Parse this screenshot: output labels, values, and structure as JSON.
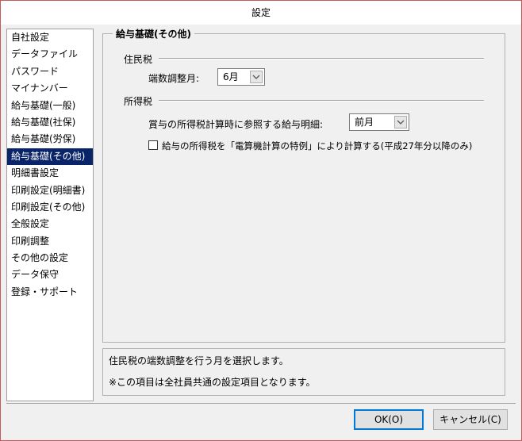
{
  "window": {
    "title": "設定"
  },
  "sidebar": {
    "items": [
      {
        "label": "自社設定"
      },
      {
        "label": "データファイル"
      },
      {
        "label": "パスワード"
      },
      {
        "label": "マイナンバー"
      },
      {
        "label": "給与基礎(一般)"
      },
      {
        "label": "給与基礎(社保)"
      },
      {
        "label": "給与基礎(労保)"
      },
      {
        "label": "給与基礎(その他)",
        "selected": true
      },
      {
        "label": "明細書設定"
      },
      {
        "label": "印刷設定(明細書)"
      },
      {
        "label": "印刷設定(その他)"
      },
      {
        "label": "全般設定"
      },
      {
        "label": "印刷調整"
      },
      {
        "label": "その他の設定"
      },
      {
        "label": "データ保守"
      },
      {
        "label": "登録・サポート"
      }
    ]
  },
  "main": {
    "group_title": "給与基礎(その他)",
    "resident_tax": {
      "section_label": "住民税",
      "rounding_month_label": "端数調整月:",
      "rounding_month_value": "6月"
    },
    "income_tax": {
      "section_label": "所得税",
      "bonus_ref_label": "賞与の所得税計算時に参照する給与明細:",
      "bonus_ref_value": "前月",
      "special_calc_checked": false,
      "special_calc_label": "給与の所得税を「電算機計算の特例」により計算する(平成27年分以降のみ)"
    }
  },
  "description": {
    "line1": "住民税の端数調整を行う月を選択します。",
    "line2": "※この項目は全社員共通の設定項目となります。"
  },
  "buttons": {
    "ok_label": "OK(O)",
    "cancel_label": "キャンセル(C)"
  },
  "colors": {
    "selection": "#0a246a",
    "window_border": "#c45a5a",
    "default_button_border": "#0078d7"
  },
  "icons": {
    "dropdown": "chevron-down-icon"
  }
}
